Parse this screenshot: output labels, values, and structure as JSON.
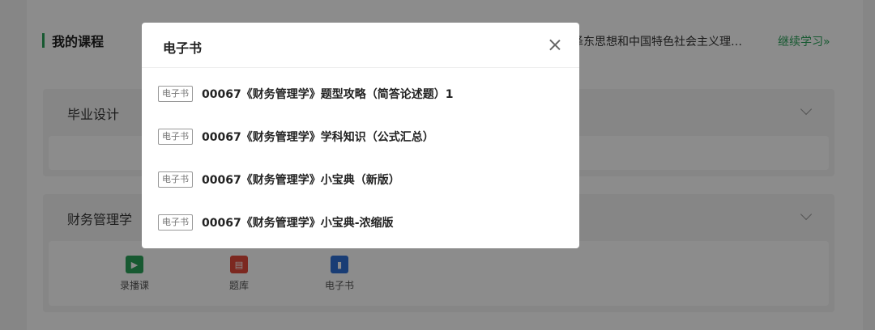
{
  "my_courses": {
    "title": "我的课程",
    "recent_course": "泽东思想和中国特色社会主义理…",
    "continue_label": "继续学习»"
  },
  "sections": [
    {
      "title": "毕业设计"
    },
    {
      "title": "财务管理学",
      "tools": [
        {
          "icon": "video-icon",
          "label": "录播课",
          "color": "#2aa35a"
        },
        {
          "icon": "question-bank-icon",
          "label": "题库",
          "color": "#e24a3b"
        },
        {
          "icon": "book-icon",
          "label": "电子书",
          "color": "#2f6fd6"
        }
      ]
    }
  ],
  "modal": {
    "title": "电子书",
    "items": [
      {
        "tag": "电子书",
        "title": "00067《财务管理学》题型攻略（简答论述题）1"
      },
      {
        "tag": "电子书",
        "title": "00067《财务管理学》学科知识（公式汇总）"
      },
      {
        "tag": "电子书",
        "title": "00067《财务管理学》小宝典（新版）"
      },
      {
        "tag": "电子书",
        "title": "00067《财务管理学》小宝典-浓缩版"
      }
    ]
  }
}
